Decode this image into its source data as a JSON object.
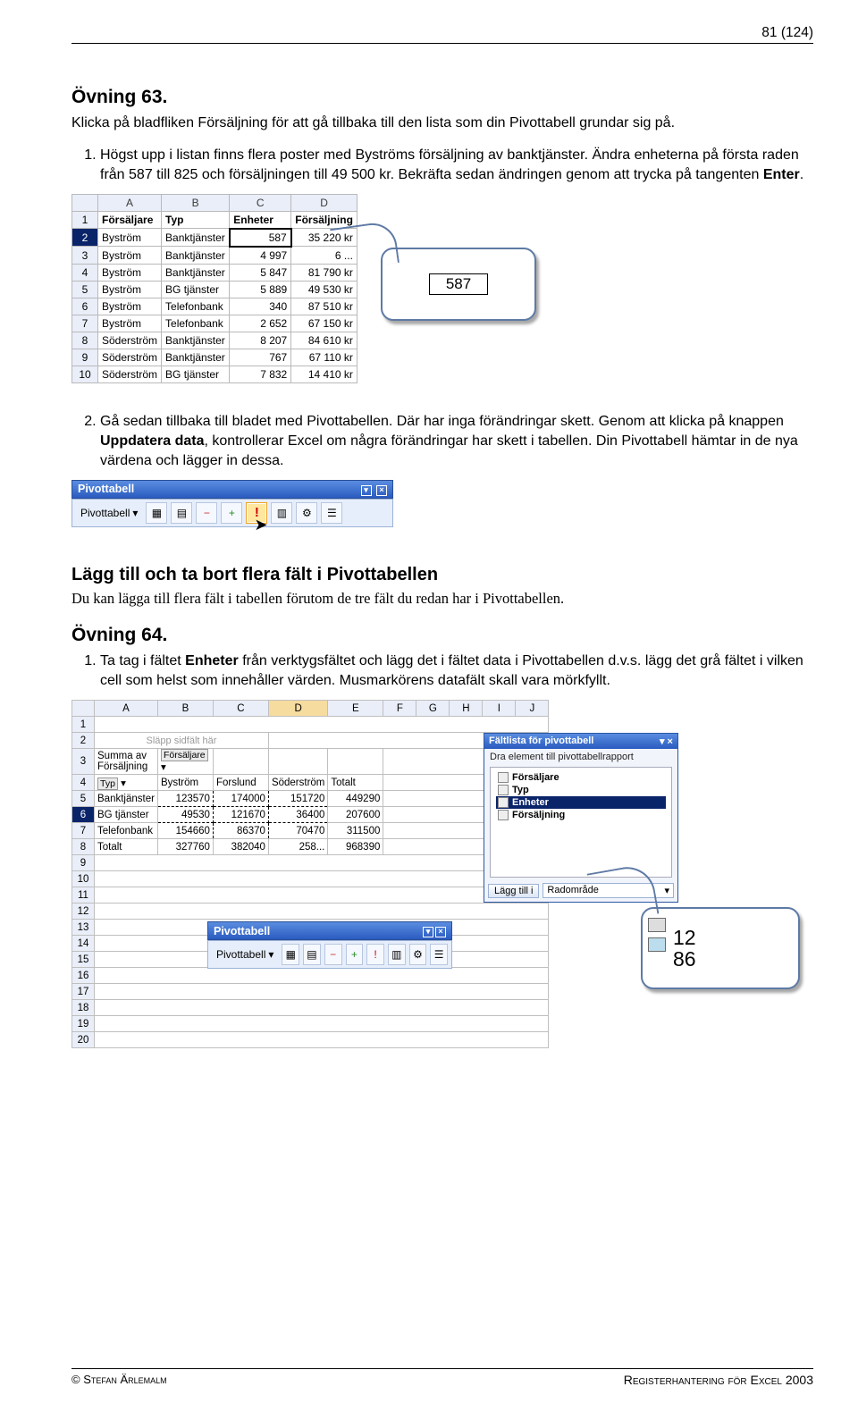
{
  "page_number": "81 (124)",
  "ov63_title": "Övning 63.",
  "ov63_intro": "Klicka på bladfliken Försäljning för att gå tillbaka till den lista som din Pivottabell grundar sig på.",
  "ov63_step1_a": "Högst upp i listan finns flera poster med Byströms försäljning av banktjänster. Ändra enheterna på första raden från 587 till 825 och försäljningen till 49 500 kr. Bekräfta sedan ändringen genom att trycka på tangenten ",
  "ov63_step1_b": "Enter",
  "ov63_step1_c": ".",
  "ov63_step2_a": "Gå sedan tillbaka till bladet med Pivottabellen. Där har inga förändringar skett. Genom att klicka på knappen ",
  "ov63_step2_b": "Uppdatera data",
  "ov63_step2_c": ", kontrollerar Excel om några förändringar har skett i tabellen. Din Pivottabell hämtar in de nya värdena och lägger in dessa.",
  "xl_cols": [
    "A",
    "B",
    "C",
    "D"
  ],
  "xl_headers": [
    "Försäljare",
    "Typ",
    "Enheter",
    "Försäljning"
  ],
  "xl_rows": [
    [
      "Byström",
      "Banktjänster",
      "587",
      "35 220 kr"
    ],
    [
      "Byström",
      "Banktjänster",
      "4 997",
      "6 ..."
    ],
    [
      "Byström",
      "Banktjänster",
      "5 847",
      "81 790 kr"
    ],
    [
      "Byström",
      "BG tjänster",
      "5 889",
      "49 530 kr"
    ],
    [
      "Byström",
      "Telefonbank",
      "340",
      "87 510 kr"
    ],
    [
      "Byström",
      "Telefonbank",
      "2 652",
      "67 150 kr"
    ],
    [
      "Söderström",
      "Banktjänster",
      "8 207",
      "84 610 kr"
    ],
    [
      "Söderström",
      "Banktjänster",
      "767",
      "67 110 kr"
    ],
    [
      "Söderström",
      "BG tjänster",
      "7 832",
      "14 410 kr"
    ]
  ],
  "callout1_value": "587",
  "toolbar_title": "Pivottabell",
  "toolbar_menu_label": "Pivottabell",
  "section2_title": "Lägg till och ta bort flera fält i Pivottabellen",
  "section2_intro": "Du kan lägga till flera fält i tabellen förutom de tre fält du redan har i Pivottabellen.",
  "ov64_title": "Övning 64.",
  "ov64_step1_a": "Ta tag i fältet ",
  "ov64_step1_b": "Enheter",
  "ov64_step1_c": " från verktygsfältet och lägg det i fältet data i Pivottabellen d.v.s. lägg det grå fältet i vilken cell som helst som innehåller värden. Musmarkörens datafält skall vara mörkfyllt.",
  "pivot_cols": [
    "A",
    "B",
    "C",
    "D",
    "E",
    "F",
    "G",
    "H",
    "I",
    "J"
  ],
  "pivot_dropzone": "Släpp sidfält här",
  "pivot_row3": "Summa av Försäljning",
  "pivot_row3_tag": "Försäljare",
  "pivot_row4": [
    "Typ",
    "Byström",
    "Forslund",
    "Söderström",
    "Totalt"
  ],
  "pivot_data": [
    [
      "Banktjänster",
      "123570",
      "174000",
      "151720",
      "449290"
    ],
    [
      "BG tjänster",
      "49530",
      "121670",
      "36400",
      "207600"
    ],
    [
      "Telefonbank",
      "154660",
      "86370",
      "70470",
      "311500"
    ],
    [
      "Totalt",
      "327760",
      "382040",
      "258...",
      "968390"
    ]
  ],
  "fieldlist_title": "Fältlista för pivottabell",
  "fieldlist_sub": "Dra element till pivottabellrapport",
  "fieldlist_items": [
    "Försäljare",
    "Typ",
    "Enheter",
    "Försäljning"
  ],
  "fieldlist_btn": "Lägg till i",
  "fieldlist_area": "Radområde",
  "callout2_line1": "12",
  "callout2_line2": "86",
  "footer_left": "© Stefan Ärlemalm",
  "footer_right": "Registerhantering för Excel 2003"
}
